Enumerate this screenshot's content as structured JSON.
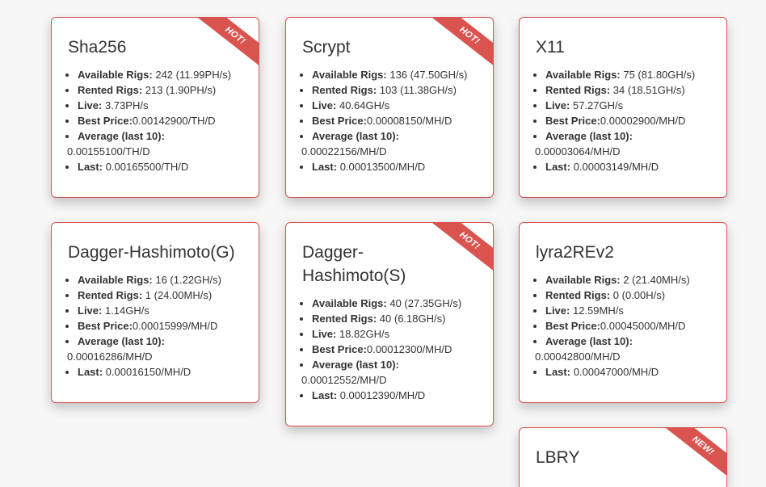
{
  "cards": [
    {
      "title": "Sha256",
      "badge": "HOT!",
      "available_label": "Available Rigs:",
      "available_value": "242 (11.99PH/s)",
      "rented_label": "Rented Rigs:",
      "rented_value": "213 (1.90PH/s)",
      "live_label": "Live:",
      "live_value": "3.73PH/s",
      "best_label": "Best Price:",
      "best_value": "0.00142900/TH/D",
      "avg_label": "Average (last 10):",
      "avg_value": "0.00155100/TH/D",
      "last_label": "Last:",
      "last_value": "0.00165500/TH/D"
    },
    {
      "title": "Scrypt",
      "badge": "HOT!",
      "available_label": "Available Rigs:",
      "available_value": "136 (47.50GH/s)",
      "rented_label": "Rented Rigs:",
      "rented_value": "103 (11.38GH/s)",
      "live_label": "Live:",
      "live_value": "40.64GH/s",
      "best_label": "Best Price:",
      "best_value": "0.00008150/MH/D",
      "avg_label": "Average (last 10):",
      "avg_value": "0.00022156/MH/D",
      "last_label": "Last:",
      "last_value": "0.00013500/MH/D"
    },
    {
      "title": "X11",
      "available_label": "Available Rigs:",
      "available_value": "75 (81.80GH/s)",
      "rented_label": "Rented Rigs:",
      "rented_value": "34 (18.51GH/s)",
      "live_label": "Live:",
      "live_value": "57.27GH/s",
      "best_label": "Best Price:",
      "best_value": "0.00002900/MH/D",
      "avg_label": "Average (last 10):",
      "avg_value": "0.00003064/MH/D",
      "last_label": "Last:",
      "last_value": "0.00003149/MH/D"
    },
    {
      "title": "Dagger-Hashimoto(G)",
      "available_label": "Available Rigs:",
      "available_value": "16 (1.22GH/s)",
      "rented_label": "Rented Rigs:",
      "rented_value": "1 (24.00MH/s)",
      "live_label": "Live:",
      "live_value": "1.14GH/s",
      "best_label": "Best Price:",
      "best_value": "0.00015999/MH/D",
      "avg_label": "Average (last 10):",
      "avg_value": "0.00016286/MH/D",
      "last_label": "Last:",
      "last_value": "0.00016150/MH/D"
    },
    {
      "title": "Dagger-Hashimoto(S)",
      "badge": "HOT!",
      "available_label": "Available Rigs:",
      "available_value": "40 (27.35GH/s)",
      "rented_label": "Rented Rigs:",
      "rented_value": "40 (6.18GH/s)",
      "live_label": "Live:",
      "live_value": "18.82GH/s",
      "best_label": "Best Price:",
      "best_value": "0.00012300/MH/D",
      "avg_label": "Average (last 10):",
      "avg_value": "0.00012552/MH/D",
      "last_label": "Last:",
      "last_value": "0.00012390/MH/D"
    },
    {
      "title": "lyra2REv2",
      "available_label": "Available Rigs:",
      "available_value": "2 (21.40MH/s)",
      "rented_label": "Rented Rigs:",
      "rented_value": "0 (0.00H/s)",
      "live_label": "Live:",
      "live_value": "12.59MH/s",
      "best_label": "Best Price:",
      "best_value": "0.00045000/MH/D",
      "avg_label": "Average (last 10):",
      "avg_value": "0.00042800/MH/D",
      "last_label": "Last:",
      "last_value": "0.00047000/MH/D"
    },
    {
      "title": "LBRY",
      "badge": "NEW!"
    }
  ]
}
